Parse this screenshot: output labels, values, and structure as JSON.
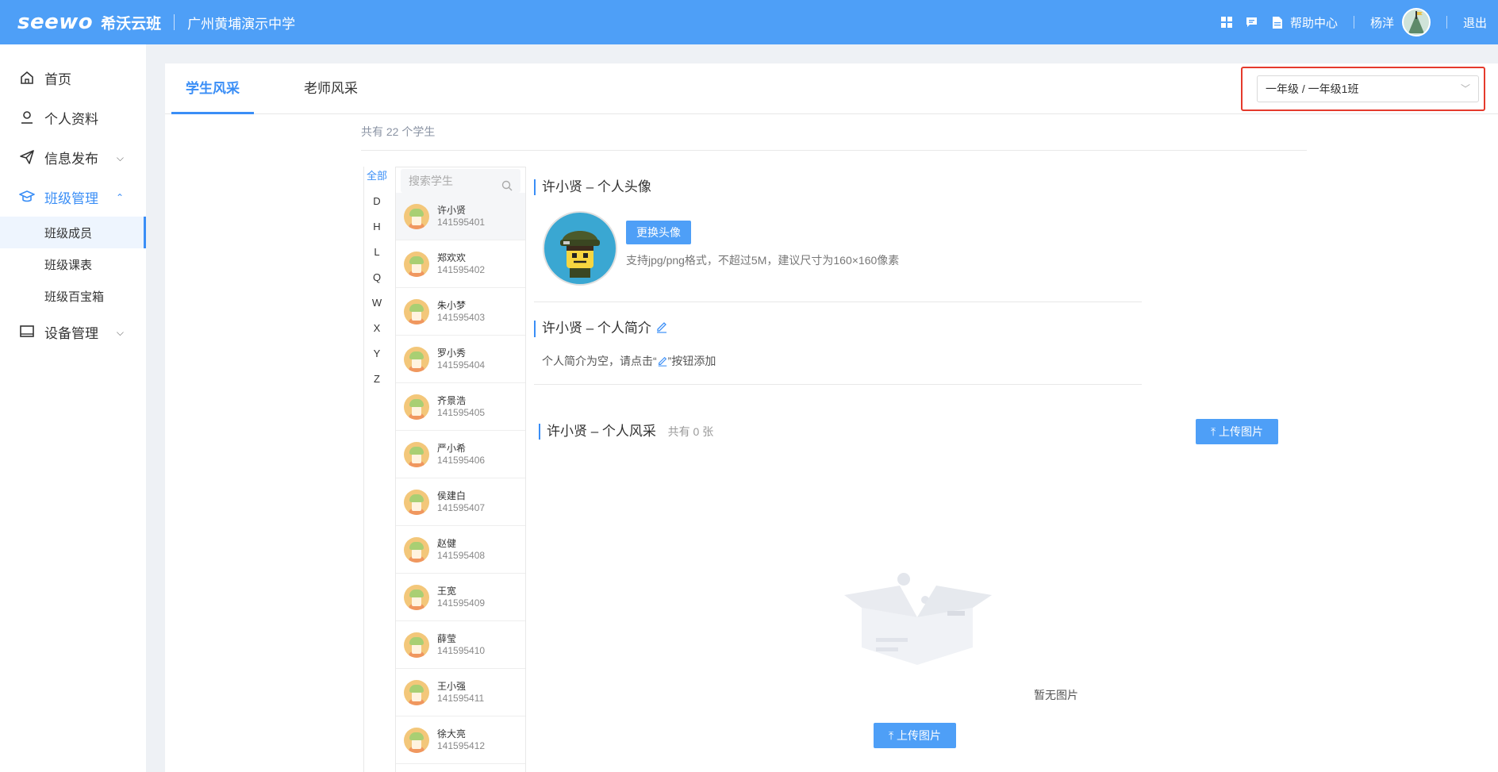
{
  "header": {
    "brand_logo": "seewo",
    "brand_name": "希沃云班",
    "school_name": "广州黄埔演示中学",
    "help_label": "帮助中心",
    "username": "杨洋",
    "logout_label": "退出"
  },
  "sidebar": {
    "items": [
      {
        "label": "首页",
        "icon": "home-icon"
      },
      {
        "label": "个人资料",
        "icon": "user-icon"
      },
      {
        "label": "信息发布",
        "icon": "send-icon"
      },
      {
        "label": "班级管理",
        "icon": "graduation-cap-icon"
      },
      {
        "label": "设备管理",
        "icon": "monitor-icon"
      }
    ],
    "class_sub": [
      "班级成员",
      "班级课表",
      "班级百宝箱"
    ]
  },
  "tabs": [
    "学生风采",
    "老师风采"
  ],
  "grade_select": {
    "value": "一年级 / 一年级1班"
  },
  "student_count": "共有 22 个学生",
  "letters": [
    "全部",
    "D",
    "H",
    "L",
    "Q",
    "W",
    "X",
    "Y",
    "Z"
  ],
  "search": {
    "placeholder": "搜索学生"
  },
  "students": [
    {
      "name": "许小贤",
      "id": "141595401"
    },
    {
      "name": "郑欢欢",
      "id": "141595402"
    },
    {
      "name": "朱小梦",
      "id": "141595403"
    },
    {
      "name": "罗小秀",
      "id": "141595404"
    },
    {
      "name": "齐景浩",
      "id": "141595405"
    },
    {
      "name": "严小希",
      "id": "141595406"
    },
    {
      "name": "侯建白",
      "id": "141595407"
    },
    {
      "name": "赵健",
      "id": "141595408"
    },
    {
      "name": "王宽",
      "id": "141595409"
    },
    {
      "name": "薛莹",
      "id": "141595410"
    },
    {
      "name": "王小强",
      "id": "141595411"
    },
    {
      "name": "徐大亮",
      "id": "141595412"
    }
  ],
  "detail": {
    "avatar_title": "许小贤 – 个人头像",
    "change_avatar_label": "更换头像",
    "avatar_hint": "支持jpg/png格式，不超过5M，建议尺寸为160×160像素",
    "bio_title": "许小贤 – 个人简介",
    "bio_empty_before": "个人简介为空，请点击“",
    "bio_empty_after": "”按钮添加",
    "gallery_title": "许小贤 – 个人风采",
    "gallery_count": "共有 0 张",
    "upload_label": "上传图片",
    "empty_text": "暂无图片"
  }
}
